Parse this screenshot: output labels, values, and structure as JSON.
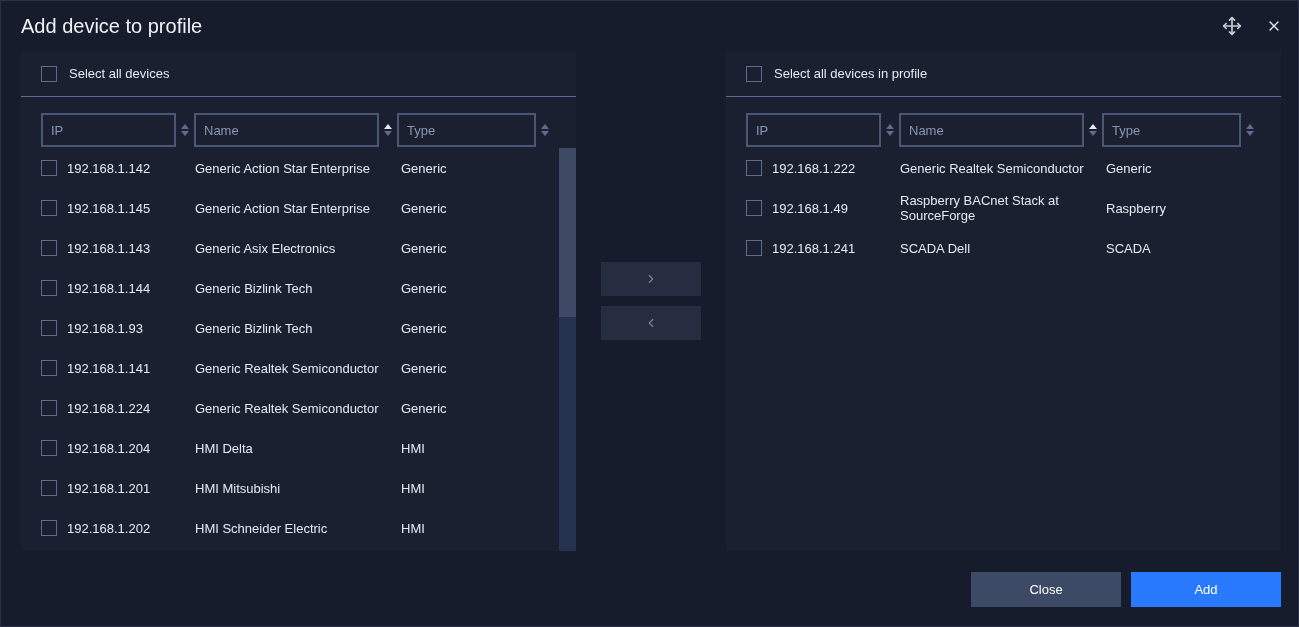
{
  "window": {
    "title": "Add device to profile"
  },
  "panels": [
    {
      "select_all": {
        "label": "Select all devices",
        "checked": false
      },
      "filters": [
        {
          "placeholder": "IP",
          "sorted": false
        },
        {
          "placeholder": "Name",
          "sorted": true
        },
        {
          "placeholder": "Type",
          "sorted": false
        }
      ],
      "rows": [
        {
          "ip": "192.168.1.142",
          "name": "Generic Action Star Enterprise",
          "type": "Generic",
          "checked": false
        },
        {
          "ip": "192.168.1.145",
          "name": "Generic Action Star Enterprise",
          "type": "Generic",
          "checked": false
        },
        {
          "ip": "192.168.1.143",
          "name": "Generic Asix Electronics",
          "type": "Generic",
          "checked": false
        },
        {
          "ip": "192.168.1.144",
          "name": "Generic Bizlink Tech",
          "type": "Generic",
          "checked": false
        },
        {
          "ip": "192.168.1.93",
          "name": "Generic Bizlink Tech",
          "type": "Generic",
          "checked": false
        },
        {
          "ip": "192.168.1.141",
          "name": "Generic Realtek Semiconductor",
          "type": "Generic",
          "checked": false
        },
        {
          "ip": "192.168.1.224",
          "name": "Generic Realtek Semiconductor",
          "type": "Generic",
          "checked": false
        },
        {
          "ip": "192.168.1.204",
          "name": "HMI Delta",
          "type": "HMI",
          "checked": false
        },
        {
          "ip": "192.168.1.201",
          "name": "HMI Mitsubishi",
          "type": "HMI",
          "checked": false
        },
        {
          "ip": "192.168.1.202",
          "name": "HMI Schneider Electric",
          "type": "HMI",
          "checked": false
        }
      ]
    },
    {
      "select_all": {
        "label": "Select all devices in profile",
        "checked": false
      },
      "filters": [
        {
          "placeholder": "IP",
          "sorted": false
        },
        {
          "placeholder": "Name",
          "sorted": true
        },
        {
          "placeholder": "Type",
          "sorted": false
        }
      ],
      "rows": [
        {
          "ip": "192.168.1.222",
          "name": "Generic Realtek Semiconductor",
          "type": "Generic",
          "checked": false
        },
        {
          "ip": "192.168.1.49",
          "name": "Raspberry BACnet Stack at SourceForge",
          "type": "Raspberry",
          "checked": false
        },
        {
          "ip": "192.168.1.241",
          "name": "SCADA Dell",
          "type": "SCADA",
          "checked": false
        }
      ]
    }
  ],
  "footer": {
    "buttons": [
      {
        "label": "Close",
        "kind": "secondary"
      },
      {
        "label": "Add",
        "kind": "primary"
      }
    ]
  }
}
